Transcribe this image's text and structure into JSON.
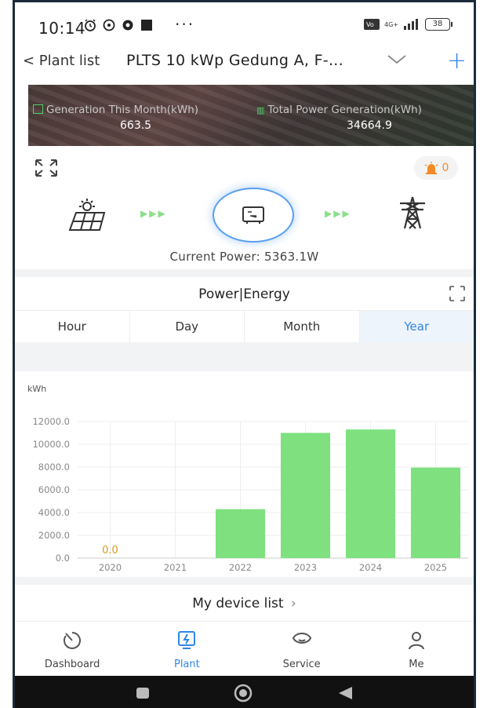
{
  "status_bar": {
    "time": "10:14",
    "dots": "···",
    "network": "4G+",
    "battery": "38"
  },
  "nav": {
    "back_label": "< Plant list",
    "title": "PLTS 10 kWp Gedung A, F-...",
    "plus_label": "+"
  },
  "banner": {
    "gen_month_label": "Generation This Month(kWh)",
    "gen_month_value": "663.5",
    "total_gen_label": "Total Power Generation(kWh)",
    "total_gen_value": "34664.9"
  },
  "alarm": {
    "count": "0",
    "color": "#f28a2a"
  },
  "flow": {
    "current_power": "Current Power: 5363.1W"
  },
  "section": {
    "title": "Power|Energy",
    "tabs": [
      {
        "label": "Hour",
        "active": false
      },
      {
        "label": "Day",
        "active": false
      },
      {
        "label": "Month",
        "active": false
      },
      {
        "label": "Year",
        "active": true
      }
    ]
  },
  "chart_data": {
    "type": "bar",
    "ylabel": "kWh",
    "categories": [
      "2020",
      "2021",
      "2022",
      "2023",
      "2024",
      "2025"
    ],
    "values": [
      0.0,
      0,
      4300,
      11000,
      11300,
      7950
    ],
    "data_labels": [
      "0.0",
      "",
      "",
      "",
      "",
      ""
    ],
    "yticks": [
      "0.0",
      "2000.0",
      "4000.0",
      "6000.0",
      "8000.0",
      "10000.0",
      "12000.0"
    ],
    "ylim": [
      0,
      12000
    ],
    "grid": true,
    "bar_color": "#7ee07e",
    "label_color": "#d89a1b"
  },
  "devices": {
    "label": "My device list",
    "chevron": "›"
  },
  "tabbar": [
    {
      "label": "Dashboard",
      "icon": "dashboard-icon",
      "active": false
    },
    {
      "label": "Plant",
      "icon": "plant-icon",
      "active": true
    },
    {
      "label": "Service",
      "icon": "service-icon",
      "active": false
    },
    {
      "label": "Me",
      "icon": "me-icon",
      "active": false
    }
  ],
  "colors": {
    "accent": "#2f86e8",
    "bar": "#7ee07e"
  }
}
